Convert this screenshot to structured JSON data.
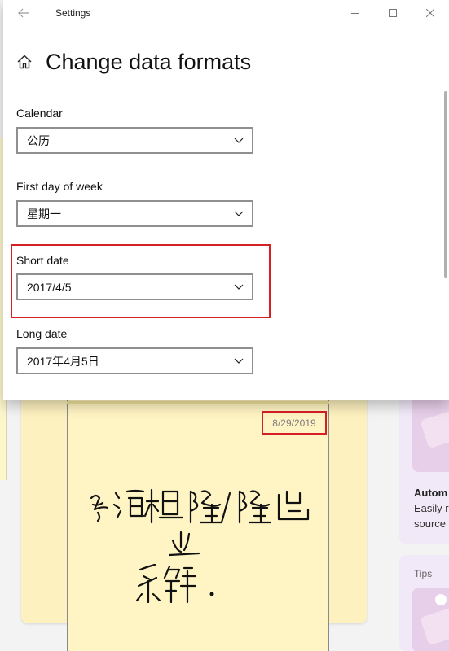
{
  "window": {
    "title": "Settings"
  },
  "page": {
    "title": "Change data formats"
  },
  "fields": [
    {
      "label": "Calendar",
      "value": "公历"
    },
    {
      "label": "First day of week",
      "value": "星期一"
    },
    {
      "label": "Short date",
      "value": "2017/4/5"
    },
    {
      "label": "Long date",
      "value": "2017年4月5日"
    }
  ],
  "note": {
    "date": "8/29/2019",
    "handwriting_lines": [
      "乞浩枫隆/隆凸",
      "业",
      "乐解."
    ]
  },
  "tips": {
    "card1_title": "Autom",
    "card1_line1": "Easily r",
    "card1_line2": "source",
    "card2_label": "Tips"
  },
  "colors": {
    "highlight": "#d71f26",
    "note_background": "#fff4c4",
    "tips_background": "#f2e9f8"
  },
  "icons": {
    "back": "back-arrow-icon",
    "minimize": "minimize-icon",
    "maximize": "maximize-icon",
    "close": "close-icon",
    "home": "home-icon",
    "dropdown": "chevron-down-icon"
  }
}
